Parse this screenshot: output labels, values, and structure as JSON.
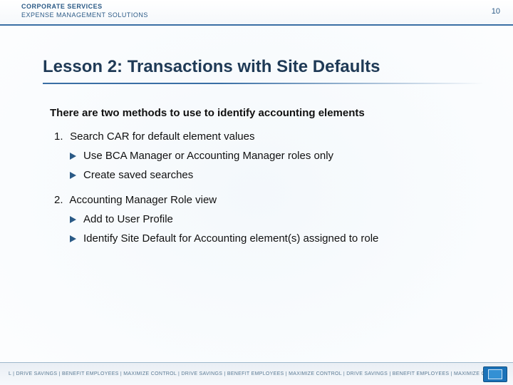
{
  "header": {
    "brand_line1": "CORPORATE SERVICES",
    "brand_line2": "EXPENSE MANAGEMENT SOLUTIONS",
    "page_number": "10"
  },
  "title": "Lesson 2:  Transactions with Site Defaults",
  "intro": "There are two methods to use to identify accounting elements",
  "items": [
    {
      "num": "1.",
      "text": "Search CAR for default element values",
      "subs": [
        "Use BCA Manager or Accounting Manager roles only",
        "Create saved searches"
      ]
    },
    {
      "num": "2.",
      "text": "Accounting Manager Role view",
      "subs": [
        "Add to User Profile",
        "Identify Site Default for Accounting element(s) assigned to role"
      ]
    }
  ],
  "footer": {
    "tagline": "L | DRIVE SAVINGS | BENEFIT EMPLOYEES | MAXIMIZE CONTROL | DRIVE SAVINGS | BENEFIT EMPLOYEES | MAXIMIZE CONTROL | DRIVE SAVINGS | BENEFIT EMPLOYEES | MAXIMIZE CONTROL | REAL BUSINESS. REAL SOLUTIONS.®"
  }
}
